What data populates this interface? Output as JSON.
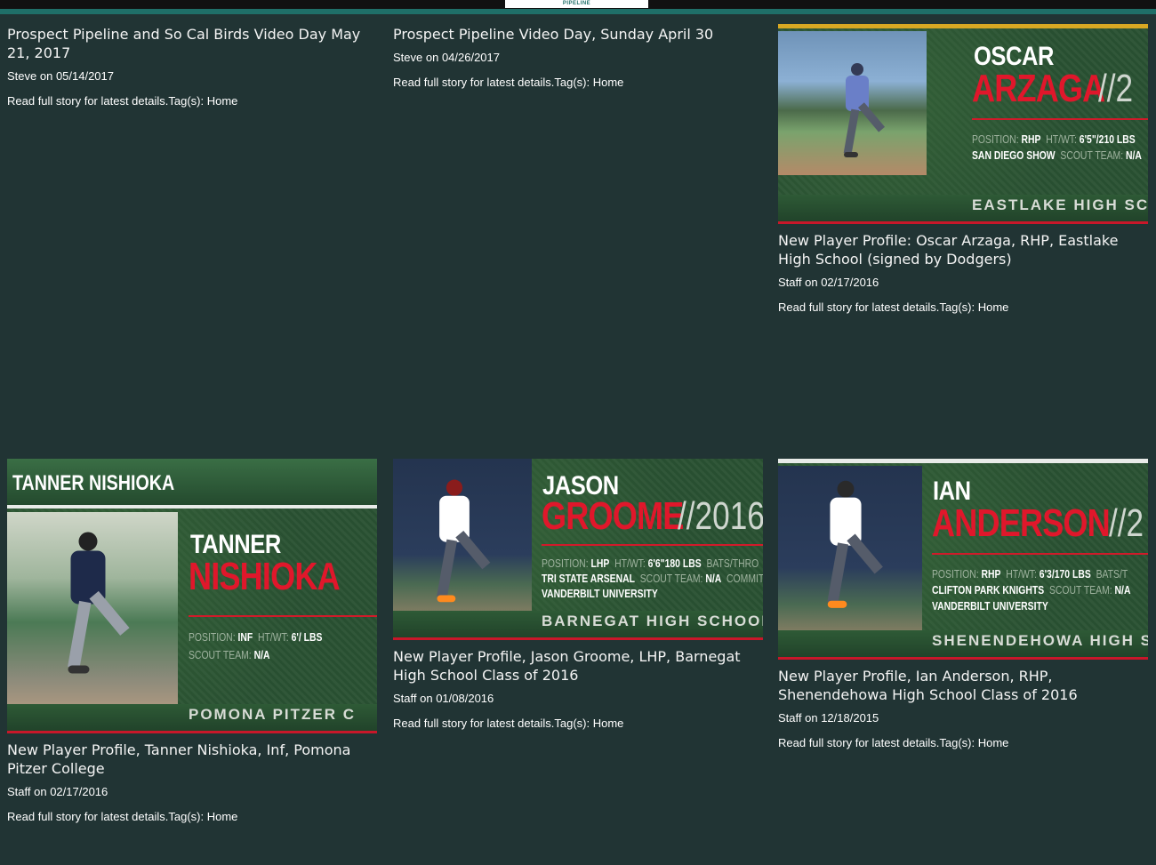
{
  "header": {
    "logo_text": "PIPELINE"
  },
  "posts": [
    {
      "title": "Prospect Pipeline and So Cal Birds Video Day May 21, 2017",
      "author": "Steve",
      "date": "05/14/2017",
      "summary": "Read full story for latest details.",
      "tag_label": "Tag(s):",
      "tag": "Home"
    },
    {
      "title": "Prospect Pipeline Video Day, Sunday April 30",
      "author": "Steve",
      "date": "04/26/2017",
      "summary": "Read full story for latest details.",
      "tag_label": "Tag(s):",
      "tag": "Home"
    },
    {
      "title": "New Player Profile: Oscar Arzaga, RHP, Eastlake High School (signed by Dodgers)",
      "author": "Staff",
      "date": "02/17/2016",
      "summary": "Read full story for latest details.",
      "tag_label": "Tag(s):",
      "tag": "Home",
      "card": {
        "first": "OSCAR",
        "last": "ARZAGA",
        "year": "//2",
        "line1_label1": "POSITION:",
        "line1_val1": "RHP",
        "line1_label2": "HT/WT:",
        "line1_val2": "6'5\"/210 LBS",
        "line2_val1": "SAN DIEGO SHOW",
        "line2_label2": "SCOUT TEAM:",
        "line2_val2": "N/A",
        "school": "EASTLAKE HIGH SCI"
      }
    },
    {
      "title": "New Player Profile, Tanner Nishioka, Inf, Pomona Pitzer College",
      "author": "Staff",
      "date": "02/17/2016",
      "summary": "Read full story for latest details.",
      "tag_label": "Tag(s):",
      "tag": "Home",
      "card": {
        "banner": "TANNER NISHIOKA",
        "first": "TANNER",
        "last": "NISHIOKA",
        "line1_label1": "POSITION:",
        "line1_val1": "INF",
        "line1_label2": "HT/WT:",
        "line1_val2": "6'/ LBS",
        "line2_label1": "SCOUT TEAM:",
        "line2_val1": "N/A",
        "school": "POMONA PITZER C"
      }
    },
    {
      "title": "New Player Profile, Jason Groome, LHP, Barnegat High School Class of 2016",
      "author": "Staff",
      "date": "01/08/2016",
      "summary": "Read full story for latest details.",
      "tag_label": "Tag(s):",
      "tag": "Home",
      "card": {
        "first": "JASON",
        "last": "GROOME",
        "year": "//2016",
        "line1_label1": "POSITION:",
        "line1_val1": "LHP",
        "line1_label2": "HT/WT:",
        "line1_val2": "6'6\"180 LBS",
        "line1_label3": "BATS/THRO",
        "line2_val1": "TRI STATE ARSENAL",
        "line2_label2": "SCOUT TEAM:",
        "line2_val2": "N/A",
        "line2_label3": "COMMITT",
        "line3_val1": "VANDERBILT UNIVERSITY",
        "school": "BARNEGAT HIGH SCHOOL"
      }
    },
    {
      "title": "New Player Profile, Ian Anderson, RHP, Shenendehowa High School Class of 2016",
      "author": "Staff",
      "date": "12/18/2015",
      "summary": "Read full story for latest details.",
      "tag_label": "Tag(s):",
      "tag": "Home",
      "card": {
        "first": "IAN",
        "last": "ANDERSON",
        "year": "//2",
        "line1_label1": "POSITION:",
        "line1_val1": "RHP",
        "line1_label2": "HT/WT:",
        "line1_val2": "6'3/170 LBS",
        "line1_label3": "BATS/T",
        "line2_val1": "CLIFTON PARK KNIGHTS",
        "line2_label2": "SCOUT TEAM:",
        "line2_val2": "N/A",
        "line3_val1": "VANDERBILT UNIVERSITY",
        "school": "SHENENDEHOWA HIGH S"
      }
    }
  ],
  "meta_joiner": " on "
}
